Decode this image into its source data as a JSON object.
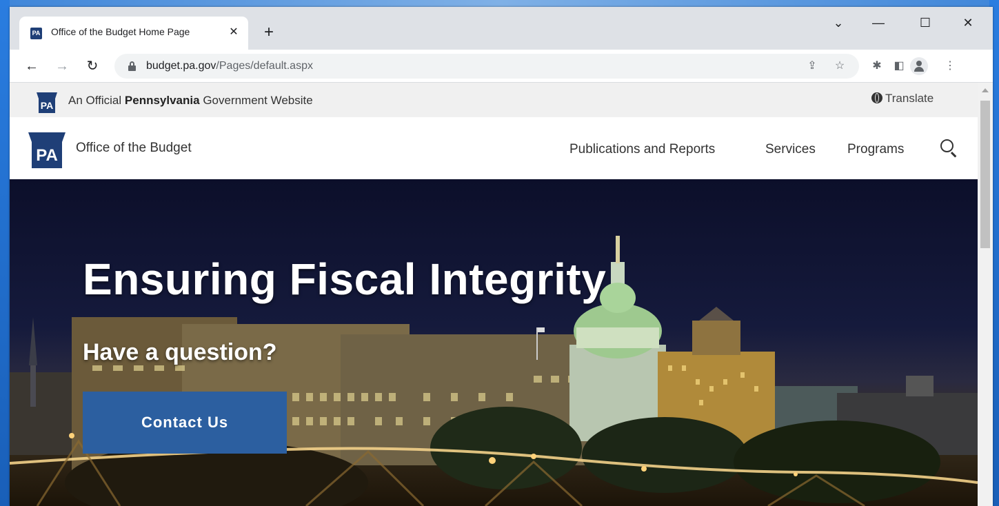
{
  "browser": {
    "tab_title": "Office of the Budget Home Page",
    "tab_favicon_text": "PA",
    "new_tab_symbol": "+",
    "close_tab_symbol": "✕",
    "url_host": "budget.pa.gov",
    "url_path": "/Pages/default.aspx"
  },
  "gov_bar": {
    "prefix": "An Official",
    "state": "Pennsylvania",
    "suffix": "Government Website",
    "translate_label": "Translate",
    "logo_text": "PA"
  },
  "header": {
    "logo_text": "PA",
    "site_name": "Office of the Budget",
    "nav": [
      {
        "label": "Publications and Reports"
      },
      {
        "label": "Services"
      },
      {
        "label": "Programs"
      }
    ]
  },
  "hero": {
    "title": "Ensuring Fiscal Integrity",
    "subtitle": "Have a question?",
    "button_label": "Contact Us"
  },
  "colors": {
    "brand_navy": "#1f3f77",
    "button_blue": "#2c5fa0"
  }
}
